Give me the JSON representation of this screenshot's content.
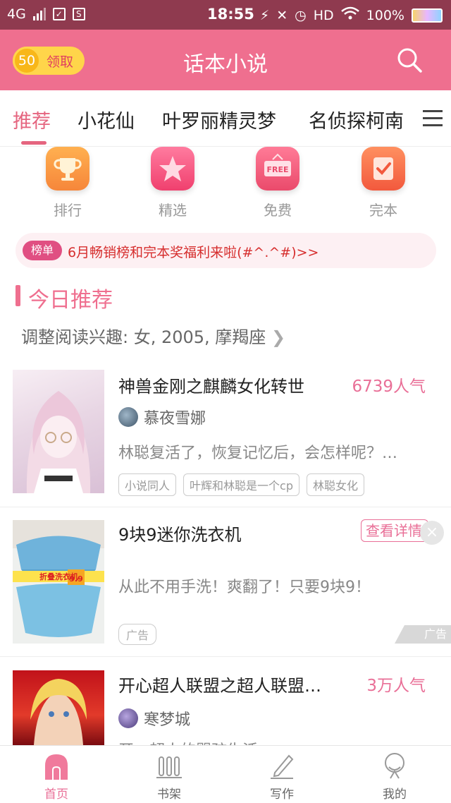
{
  "status_bar": {
    "network": "4G",
    "time": "18:55",
    "hd": "HD",
    "battery": "100%"
  },
  "header": {
    "coin_value": "50",
    "coin_label": "领取",
    "title": "话本小说"
  },
  "tabs": [
    {
      "label": "推荐",
      "active": true
    },
    {
      "label": "小花仙"
    },
    {
      "label": "叶罗丽精灵梦"
    },
    {
      "label": "名侦探柯南"
    }
  ],
  "quick_entries": [
    {
      "label": "排行",
      "icon": "trophy-icon",
      "color": "#f6963a"
    },
    {
      "label": "精选",
      "icon": "star-icon",
      "color": "#f3567e"
    },
    {
      "label": "免费",
      "icon": "free-icon",
      "color": "#f05a77"
    },
    {
      "label": "完本",
      "icon": "check-icon",
      "color": "#f4734b"
    }
  ],
  "notice": {
    "badge": "榜单",
    "text": "6月畅销榜和完本奖福利来啦(#^.^#)>>"
  },
  "section": {
    "title": "今日推荐",
    "interest": "调整阅读兴趣: 女, 2005, 摩羯座"
  },
  "cards": [
    {
      "title": "神兽金刚之麒麟女化转世",
      "popularity": "6739人气",
      "author": "慕夜雪娜",
      "desc": "林聪复活了，恢复记忆后，会怎样呢？…",
      "tags": [
        "小说同人",
        "叶辉和林聪是一个cp",
        "林聪女化"
      ]
    },
    {
      "title": "9块9迷你洗衣机",
      "button": "查看详情",
      "desc": "从此不用手洗！爽翻了！只要9块9！",
      "ad_tag": "广告",
      "ad_corner": "广告",
      "cover_text": "折叠洗衣机",
      "cover_price": "9.9"
    },
    {
      "title": "开心超人联盟之超人联盟…",
      "popularity": "3万人气",
      "author": "寒梦城",
      "desc": "开：超人的婴孩生活"
    }
  ],
  "bottom_nav": [
    {
      "label": "首页",
      "active": true
    },
    {
      "label": "书架"
    },
    {
      "label": "写作"
    },
    {
      "label": "我的"
    }
  ],
  "colors": {
    "primary": "#ef6f8f",
    "status_bar": "#8f3a4f"
  }
}
